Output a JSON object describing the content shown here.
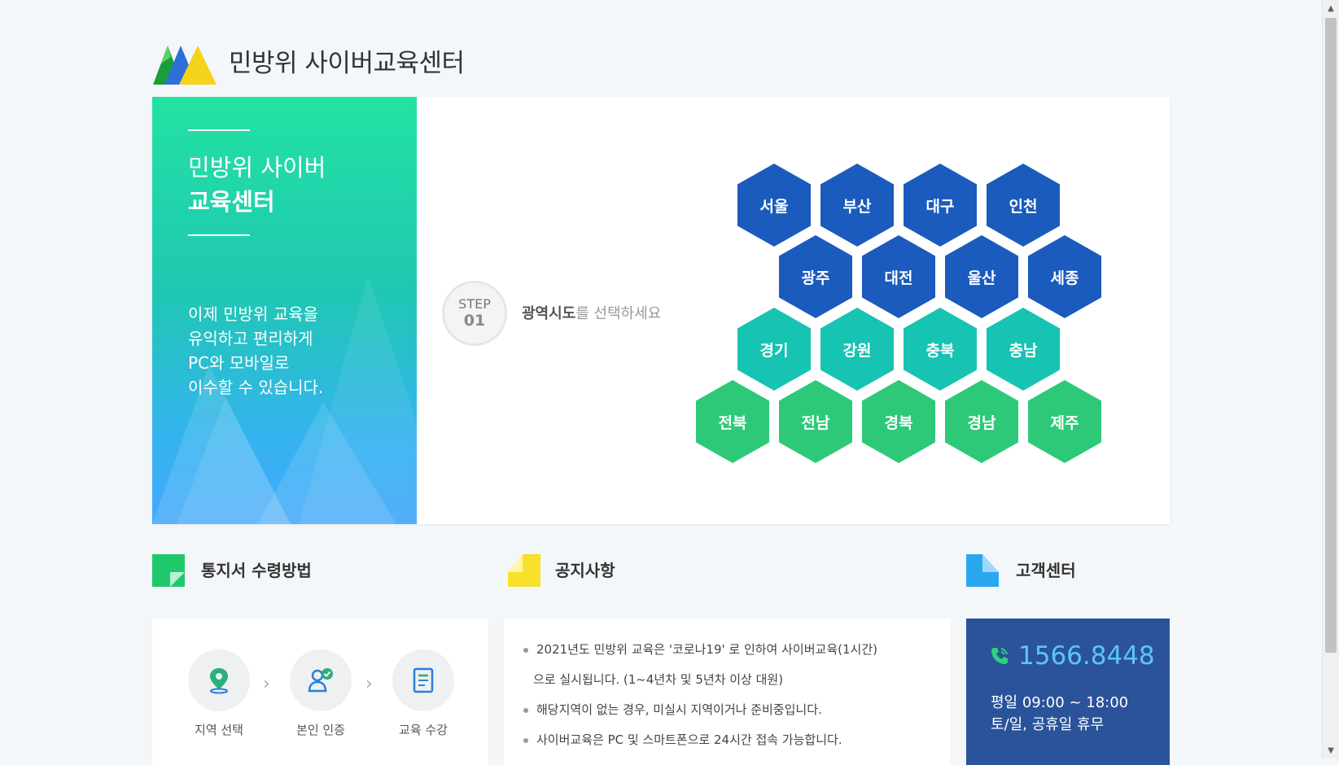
{
  "header": {
    "title": "민방위 사이버교육센터",
    "logo_icon": "mountain-logo-icon"
  },
  "hero": {
    "title_line1": "민방위 사이버",
    "title_line2": "교육센터",
    "description": " 이제 민방위 교육을\n유익하고 편리하게\nPC와 모바일로\n이수할 수 있습니다.",
    "step_word": "STEP",
    "step_number": "01",
    "step_bold": "광역시도",
    "step_rest": "를 선택하세요",
    "regions_row1": [
      "서울",
      "부산",
      "대구",
      "인천"
    ],
    "regions_row2": [
      "광주",
      "대전",
      "울산",
      "세종"
    ],
    "regions_row3": [
      "경기",
      "강원",
      "충북",
      "충남"
    ],
    "regions_row4": [
      "전북",
      "전남",
      "경북",
      "경남",
      "제주"
    ]
  },
  "sections": {
    "notice_receipt": "통지서 수령방법",
    "announcements": "공지사항",
    "customer_center": "고객센터"
  },
  "process": {
    "steps": [
      "지역 선택",
      "본인 인증",
      "교육 수강"
    ],
    "icons": [
      "map-pin-icon",
      "user-check-icon",
      "document-icon"
    ]
  },
  "notices": [
    "2021년도 민방위 교육은 '코로나19' 로 인하여 사이버교육(1시간)",
    "으로 실시됩니다. (1~4년차 및 5년차 이상 대원)",
    "해당지역이 없는 경우, 미실시 지역이거나 준비중입니다.",
    "사이버교육은 PC 및 스마트폰으로 24시간 접속 가능합니다."
  ],
  "customer": {
    "phone": "1566.8448",
    "hours": "평일 09:00 ~ 18:00\n토/일, 공휴일 휴무"
  },
  "colors": {
    "region_blue": "#1a5bbd",
    "region_teal": "#17c3b2",
    "region_green": "#2dc979",
    "customer_bg": "#2a5399",
    "phone_accent": "#5ec3ff"
  }
}
